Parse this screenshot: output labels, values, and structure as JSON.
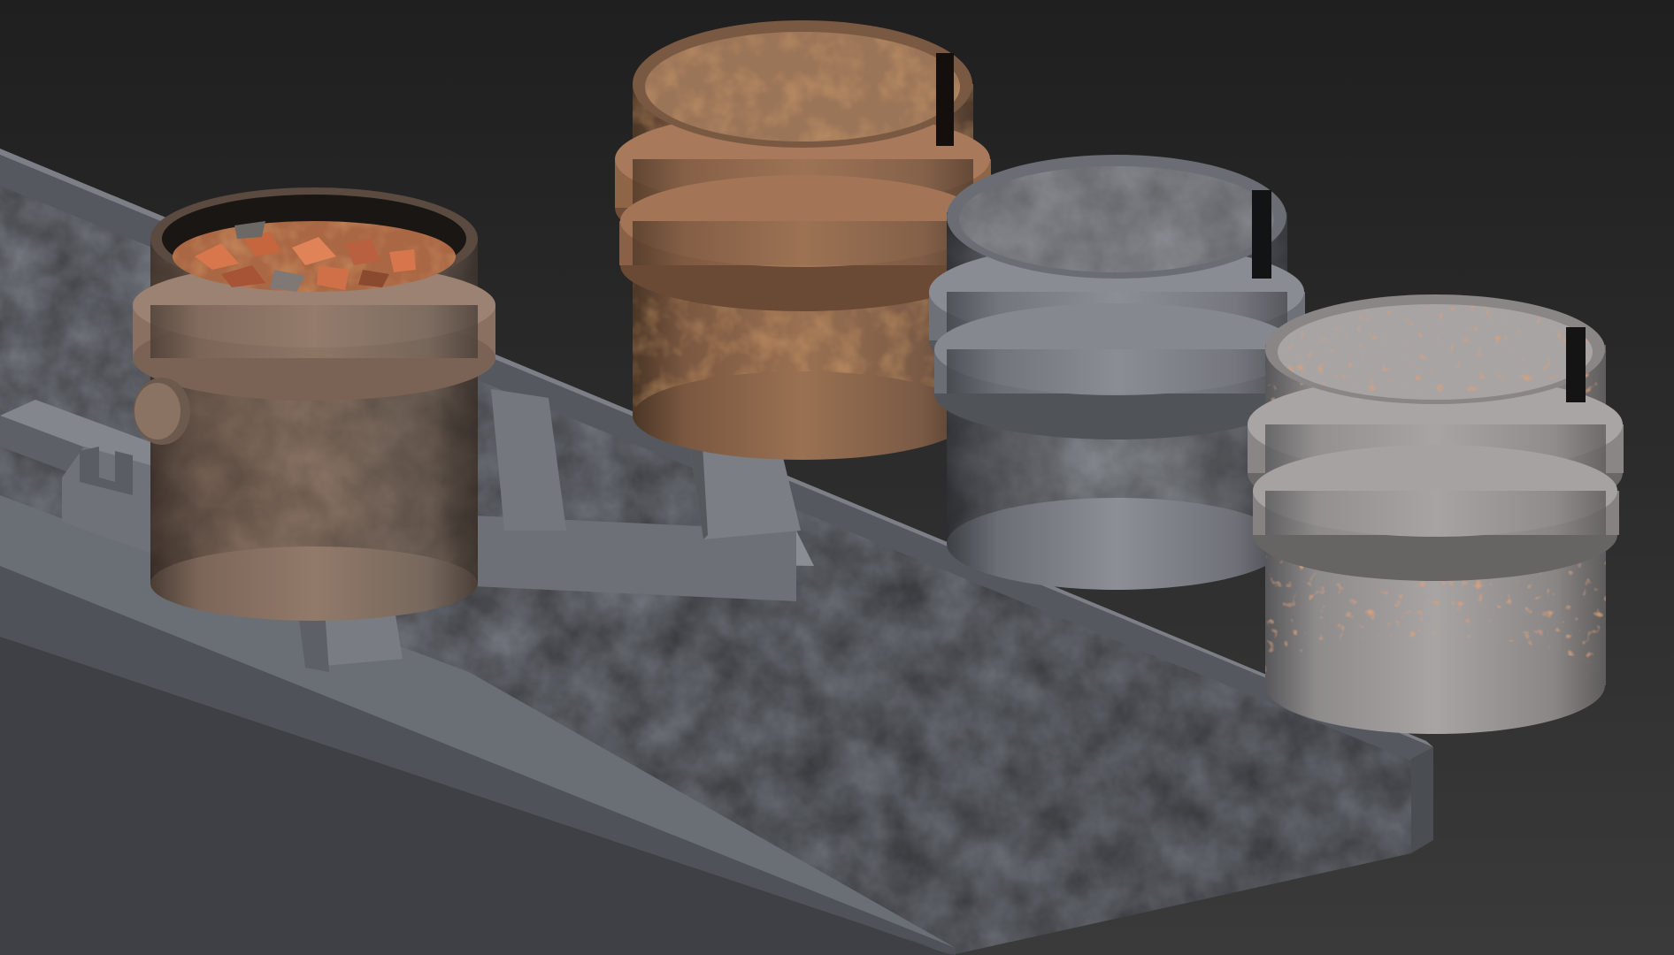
{
  "scene": {
    "kind": "3d-render-viewport",
    "background": "#2a2a2a",
    "objects": [
      {
        "id": "ladle-with-scrap",
        "material": "rusted-steel",
        "contents": "scrap-metal",
        "color": "#8a6f5e"
      },
      {
        "id": "ladle-rusty",
        "material": "heavy-rust",
        "color": "#8c6448"
      },
      {
        "id": "ladle-grey",
        "material": "grey-steel",
        "color": "#7d8087"
      },
      {
        "id": "ladle-spotted",
        "material": "spotted-rust",
        "color": "#9a9797"
      },
      {
        "id": "ladle-stand-platform",
        "material": "concrete",
        "color": "#7b7f86"
      }
    ],
    "colors": {
      "concrete_dark": "#4e5157",
      "concrete_light": "#8a8d94",
      "rust": "#b46a3a",
      "scrap": "#d27a52"
    }
  }
}
